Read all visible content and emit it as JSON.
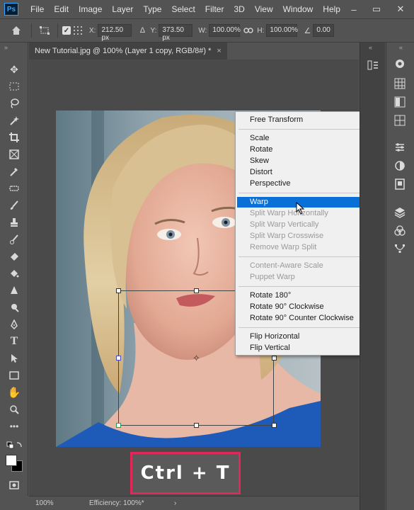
{
  "app": {
    "logo": "Ps"
  },
  "menu": [
    "File",
    "Edit",
    "Image",
    "Layer",
    "Type",
    "Select",
    "Filter",
    "3D",
    "View",
    "Window",
    "Help"
  ],
  "window_controls": {
    "minimize": "–",
    "maximize": "▭",
    "close": "✕"
  },
  "options_bar": {
    "x_label": "X:",
    "x_value": "212.50 px",
    "y_label": "Y:",
    "y_value": "373.50 px",
    "w_label": "W:",
    "w_value": "100.00%",
    "h_label": "H:",
    "h_value": "100.00%",
    "angle_value": "0.00"
  },
  "document": {
    "tab_title": "New Tutorial.jpg @ 100% (Layer 1 copy, RGB/8#) *",
    "tab_close": "×"
  },
  "context_menu": {
    "items": [
      {
        "label": "Free Transform",
        "state": "normal"
      },
      {
        "label": "Scale",
        "state": "normal"
      },
      {
        "label": "Rotate",
        "state": "normal"
      },
      {
        "label": "Skew",
        "state": "normal"
      },
      {
        "label": "Distort",
        "state": "normal"
      },
      {
        "label": "Perspective",
        "state": "normal"
      },
      {
        "label": "Warp",
        "state": "selected"
      },
      {
        "label": "Split Warp Horizontally",
        "state": "disabled"
      },
      {
        "label": "Split Warp Vertically",
        "state": "disabled"
      },
      {
        "label": "Split Warp Crosswise",
        "state": "disabled"
      },
      {
        "label": "Remove Warp Split",
        "state": "disabled"
      },
      {
        "label": "Content-Aware Scale",
        "state": "disabled"
      },
      {
        "label": "Puppet Warp",
        "state": "disabled"
      },
      {
        "label": "Rotate 180°",
        "state": "normal"
      },
      {
        "label": "Rotate 90° Clockwise",
        "state": "normal"
      },
      {
        "label": "Rotate 90° Counter Clockwise",
        "state": "normal"
      },
      {
        "label": "Flip Horizontal",
        "state": "normal"
      },
      {
        "label": "Flip Vertical",
        "state": "normal"
      }
    ]
  },
  "shortcut_overlay": {
    "text": "Ctrl + T"
  },
  "status_bar": {
    "zoom": "100%",
    "info": "Efficiency: 100%*",
    "arrow": "›"
  },
  "colors": {
    "accent_selection": "#0a6fd6",
    "shortcut_border": "#e0285a",
    "ui_background": "#535353"
  }
}
